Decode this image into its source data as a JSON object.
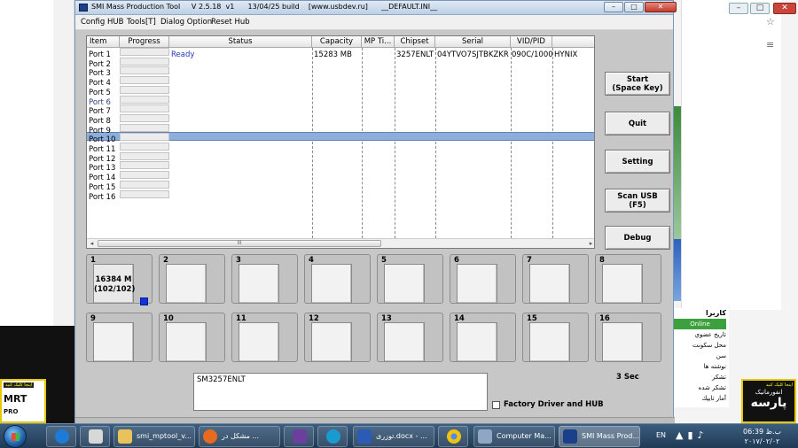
{
  "window": {
    "title": "SMI Mass Production Tool     V 2.5.18  v1      13/04/25 build    [www.usbdev.ru]      __DEFAULT.INI__",
    "controls": {
      "minimize": "–",
      "maximize": "□",
      "close": "✕"
    }
  },
  "menu": [
    "Config HUB",
    "Tools[T]",
    "Dialog Option",
    "Reset Hub"
  ],
  "table": {
    "columns": [
      "Item",
      "Progress",
      "Status",
      "Capacity",
      "MP Ti...",
      "Chipset",
      "Serial",
      "VID/PID",
      ""
    ],
    "rows": [
      {
        "port": "Port 1",
        "status": "Ready",
        "capacity": "15283 MB",
        "mp_time": "",
        "chipset": "3257ENLT",
        "serial": "04YTVO7SJTBKZKR",
        "vidpid": "090C/1000",
        "flash": "HYNIX"
      },
      {
        "port": "Port 2"
      },
      {
        "port": "Port 3"
      },
      {
        "port": "Port 4"
      },
      {
        "port": "Port 5"
      },
      {
        "port": "Port 6",
        "selected": true
      },
      {
        "port": "Port 7"
      },
      {
        "port": "Port 8"
      },
      {
        "port": "Port 9"
      },
      {
        "port": "Port 10"
      },
      {
        "port": "Port 11"
      },
      {
        "port": "Port 12"
      },
      {
        "port": "Port 13"
      },
      {
        "port": "Port 14"
      },
      {
        "port": "Port 15"
      },
      {
        "port": "Port 16"
      }
    ],
    "scroll_thumb_label": "III",
    "scroll_left": "◂",
    "scroll_right": "▸"
  },
  "buttons": {
    "start": "Start\n(Space Key)",
    "quit": "Quit",
    "setting": "Setting",
    "scan_usb": "Scan USB\n(F5)",
    "debug": "Debug"
  },
  "slots": [
    {
      "num": "1",
      "text": "16384 M\n(102/102)",
      "active": true
    },
    {
      "num": "2"
    },
    {
      "num": "3"
    },
    {
      "num": "4"
    },
    {
      "num": "5"
    },
    {
      "num": "6"
    },
    {
      "num": "7"
    },
    {
      "num": "8"
    },
    {
      "num": "9"
    },
    {
      "num": "10"
    },
    {
      "num": "11"
    },
    {
      "num": "12"
    },
    {
      "num": "13"
    },
    {
      "num": "14"
    },
    {
      "num": "15"
    },
    {
      "num": "16"
    }
  ],
  "model_text": "SM3257ENLT",
  "timer_text": "3 Sec",
  "factory_label": "Factory Driver and HUB",
  "colors": {
    "status_ready": "#2438b8",
    "selected_row": "#8daedb",
    "slot_led": "#1034e0",
    "window_bg": "#c7c7c7"
  },
  "background": {
    "mrt_tag": "اینجا کلیک کنید",
    "mrt_text": "MRT",
    "mrt_small": "PRO",
    "persian_lines": [
      "كاربرا",
      "Online",
      "تاريخ عضوي",
      "محل سكونت",
      "سن",
      "نوشته ها",
      "تشكر",
      "تشكر شده",
      "آمار تايپك"
    ],
    "parse_tag": "اینجا کلیک کنید",
    "parse_a": "انفورماتیک",
    "parse_b": "پارسه"
  },
  "taskbar": {
    "items": [
      "",
      "",
      "",
      "smi_mptool_v...",
      "مشکل در ...",
      "",
      "",
      "توزری.docx - ...",
      "",
      "Computer Ma...",
      "SMI Mass Prod..."
    ],
    "language": "EN",
    "clock_time": "06:39 ب.ظ",
    "clock_date": "۲۰۱۷/۰۲/۰۲"
  }
}
